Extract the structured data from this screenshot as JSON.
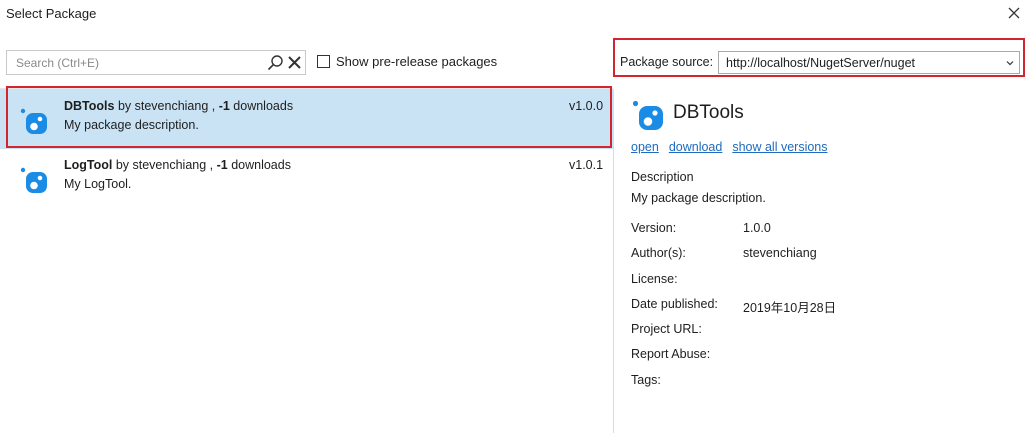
{
  "window": {
    "title": "Select Package"
  },
  "search": {
    "placeholder": "Search (Ctrl+E)",
    "value": ""
  },
  "prerelease": {
    "label": "Show pre-release packages",
    "checked": false
  },
  "source": {
    "label": "Package source:",
    "value": "http://localhost/NugetServer/nuget"
  },
  "packages": [
    {
      "name": "DBTools",
      "by": " by stevenchiang , ",
      "downloads": "-1",
      "downloads_label": " downloads",
      "description": "My package description.",
      "version": "v1.0.0",
      "selected": true
    },
    {
      "name": "LogTool",
      "by": " by stevenchiang , ",
      "downloads": "-1",
      "downloads_label": " downloads",
      "description": "My LogTool.",
      "version": "v1.0.1",
      "selected": false
    }
  ],
  "detail": {
    "title": "DBTools",
    "links": {
      "open": "open",
      "download": "download",
      "show_all": "show all versions"
    },
    "description_label": "Description",
    "description": "My package description.",
    "fields": {
      "version": {
        "label": "Version:",
        "value": "1.0.0"
      },
      "authors": {
        "label": "Author(s):",
        "value": "stevenchiang"
      },
      "license": {
        "label": "License:",
        "value": ""
      },
      "date": {
        "label": "Date published:",
        "value": "2019年10月28日"
      },
      "project_url": {
        "label": "Project URL:",
        "value": ""
      },
      "report_abuse": {
        "label": "Report Abuse:",
        "value": ""
      },
      "tags": {
        "label": "Tags:",
        "value": ""
      }
    }
  },
  "colors": {
    "selection": "#c9e3f5",
    "highlight_frame": "#d3252f",
    "link": "#1f6bbf",
    "icon_blue": "#1a8ce5"
  },
  "icons": {
    "package": "nuget-package-icon",
    "search": "search-icon",
    "clear": "close-icon",
    "window_close": "close-icon"
  }
}
